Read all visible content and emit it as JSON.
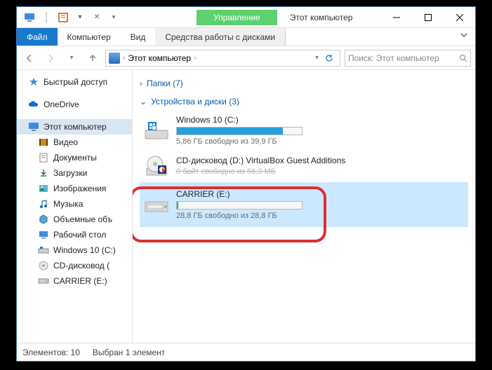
{
  "titlebar": {
    "manage_label": "Управление",
    "window_title": "Этот компьютер"
  },
  "tabs": {
    "file": "Файл",
    "computer": "Компьютер",
    "view": "Вид",
    "context": "Средства работы с дисками"
  },
  "address": {
    "path_label": "Этот компьютер",
    "search_placeholder": "Поиск: Этот компьютер"
  },
  "sidebar": {
    "quick_access": "Быстрый доступ",
    "onedrive": "OneDrive",
    "this_pc": "Этот компьютер",
    "videos": "Видео",
    "documents": "Документы",
    "downloads": "Загрузки",
    "pictures": "Изображения",
    "music": "Музыка",
    "objects3d": "Объемные объ",
    "desktop": "Рабочий стол",
    "drive_c": "Windows 10 (C:)",
    "drive_d": "CD-дисковод (",
    "drive_e": "CARRIER (E:)"
  },
  "content": {
    "folders_header": "Папки (7)",
    "devices_header": "Устройства и диски (3)",
    "drives": [
      {
        "name": "Windows 10 (C:)",
        "sub": "5,86 ГБ свободно из 39,9 ГБ",
        "fill_pct": 85
      },
      {
        "name": "CD-дисковод (D:) VirtualBox Guest Additions",
        "sub": "0 байт свободно из 56,3 МБ"
      },
      {
        "name": "CARRIER (E:)",
        "sub": "28,8 ГБ свободно из 28,8 ГБ",
        "fill_pct": 1
      }
    ]
  },
  "statusbar": {
    "count": "Элементов: 10",
    "selection": "Выбран 1 элемент"
  }
}
